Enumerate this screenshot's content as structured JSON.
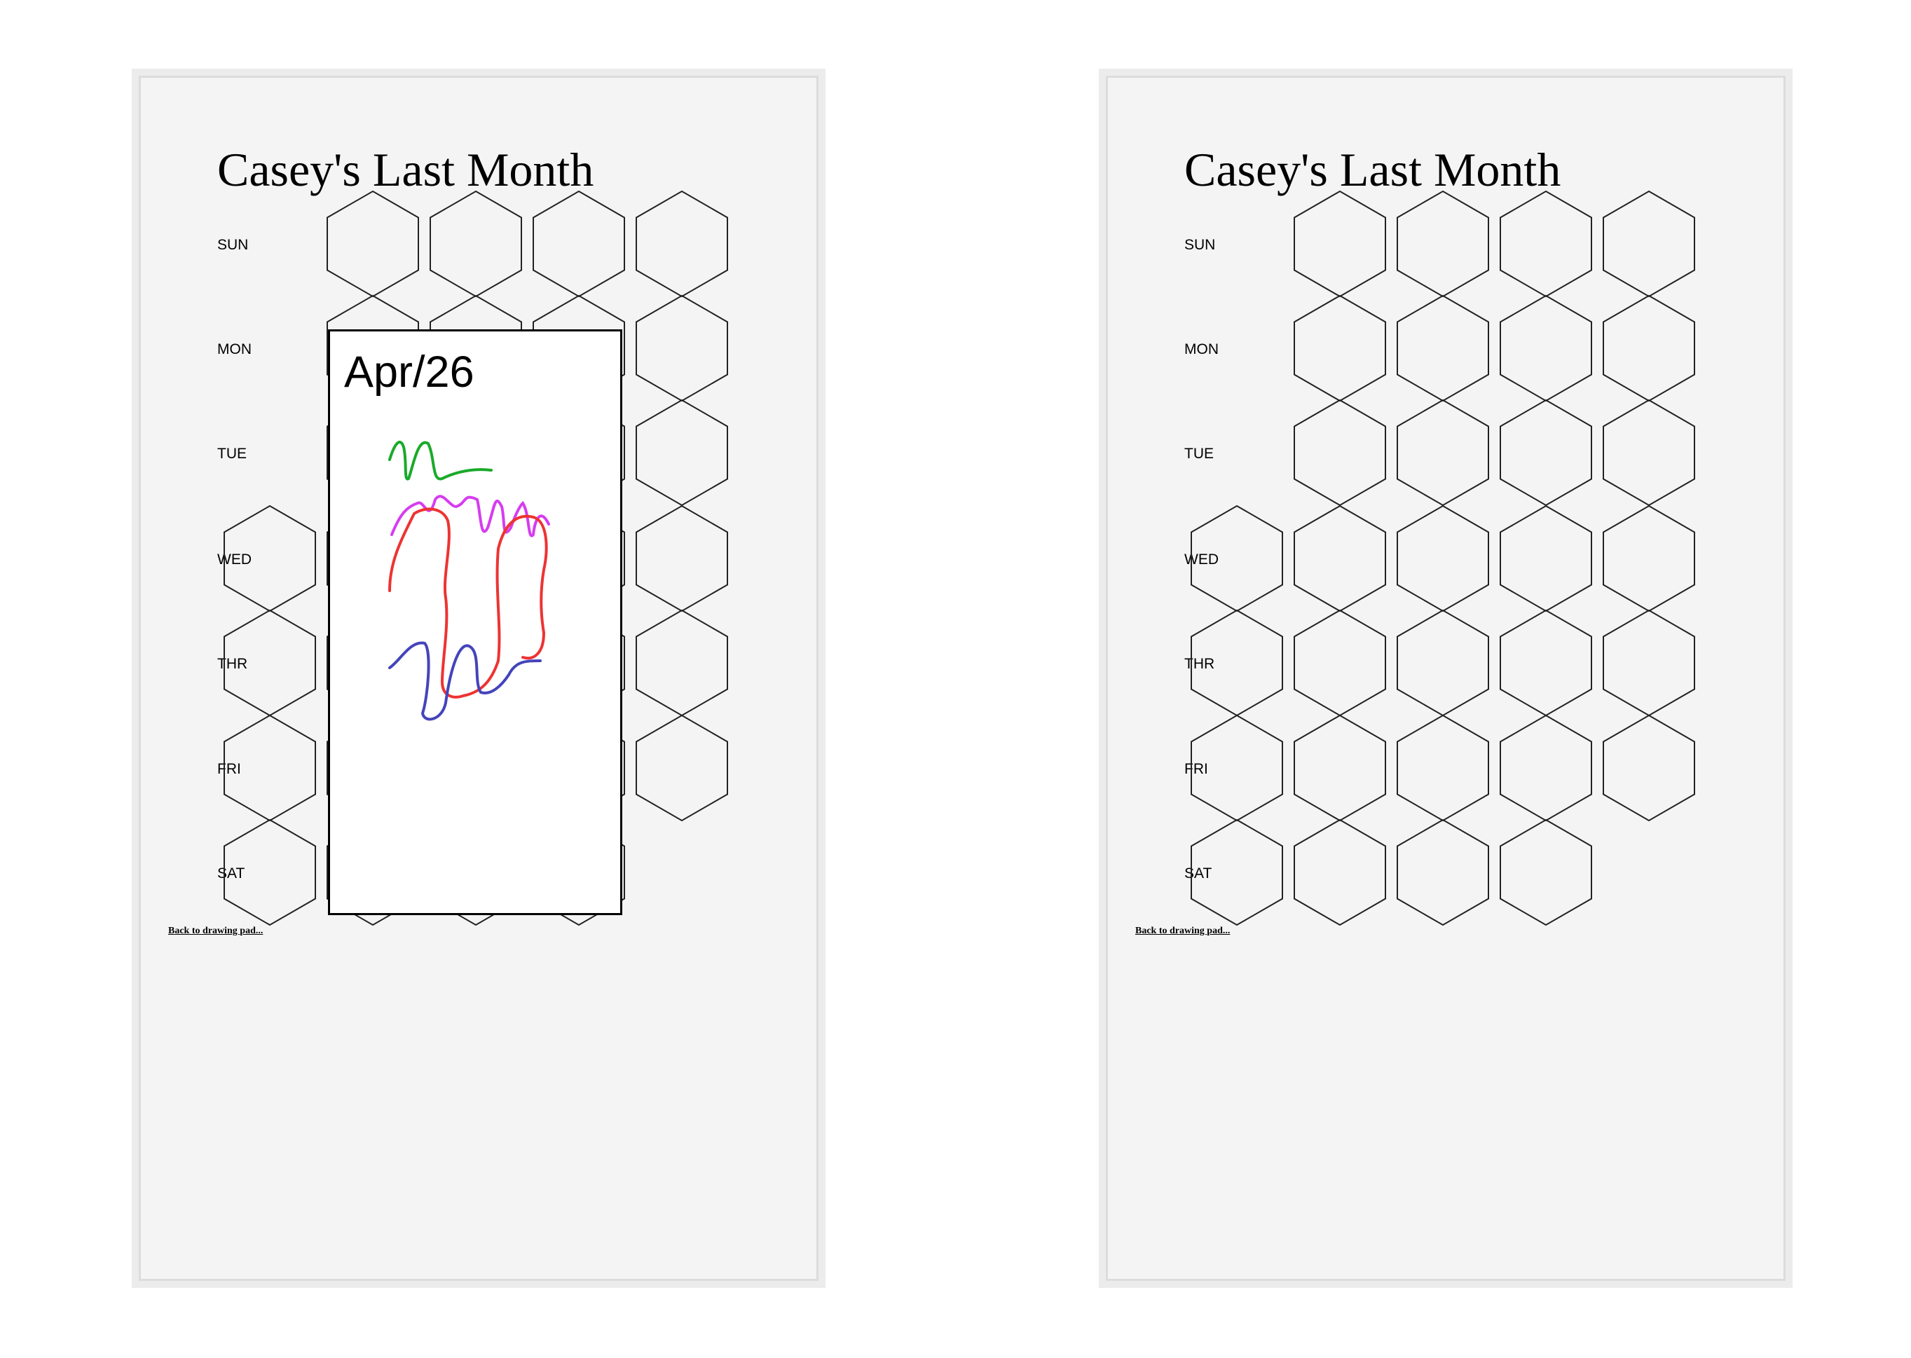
{
  "screens": [
    {
      "id": "left",
      "title": "Casey's Last Month",
      "days": [
        "SUN",
        "MON",
        "TUE",
        "WED",
        "THR",
        "FRI",
        "SAT"
      ],
      "back_link": "Back to drawing pad...",
      "popup": {
        "visible": true,
        "date": "Apr/26"
      }
    },
    {
      "id": "right",
      "title": "Casey's Last Month",
      "days": [
        "SUN",
        "MON",
        "TUE",
        "WED",
        "THR",
        "FRI",
        "SAT"
      ],
      "back_link": "Back to drawing pad...",
      "popup": {
        "visible": false
      }
    }
  ],
  "palette": {
    "orange": "#f7941d",
    "green": "#1aaa2a",
    "magenta": "#d63cf0",
    "red": "#ee3333",
    "blue": "#4444bb",
    "cyan": "#22c7d6",
    "purple": "#5b1499",
    "hex_stroke": "#222222",
    "screen_bg": "#f4f4f4"
  },
  "icons": {
    "cell": "hexagon",
    "scribble": "drawing-thumbnail"
  }
}
